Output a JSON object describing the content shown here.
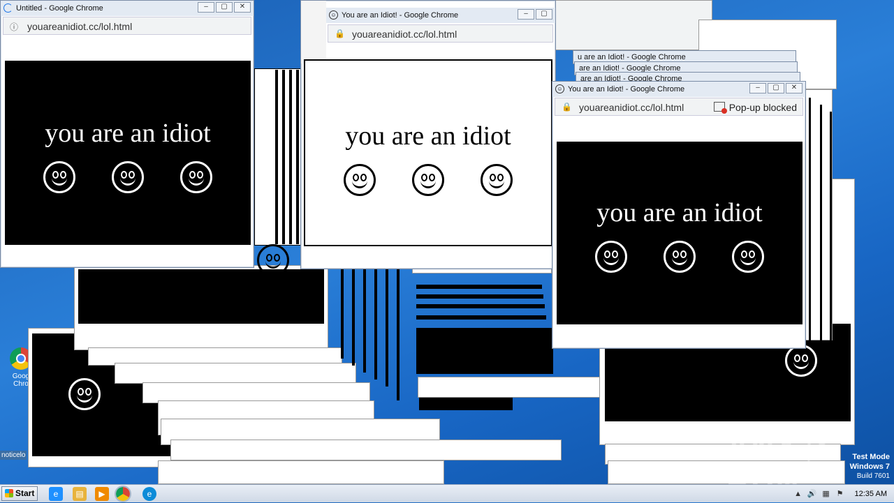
{
  "desktop": {
    "icon_chrome_label": "Goog\nChro",
    "icon_bottom_label": "noticelo",
    "watermark": "ANY ▷ RUN",
    "testmode": {
      "line1": "Test Mode",
      "line2": "Windows 7",
      "line3": "Build 7601"
    }
  },
  "popups": {
    "main_text": "you are an idiot",
    "url": "youareanidiot.cc/lol.html",
    "win1_title": "Untitled - Google Chrome",
    "win2_title": "You are an Idiot! - Google Chrome",
    "win3_title": "You are an Idiot! - Google Chrome",
    "popup_blocked": "Pop-up blocked",
    "bg_title_top": "You are an Idiot! - Google Chrome",
    "bg_title_a": "u are an Idiot! - Google Chrome",
    "bg_title_b": "are an Idiot! - Google Chrome",
    "bg_title_c": "are an Idiot! - Google Chrome"
  },
  "taskbar": {
    "start_label": "Start",
    "clock": "12:35 AM",
    "pinned": [
      "internet-explorer-icon",
      "file-explorer-icon",
      "media-player-icon",
      "chrome-icon",
      "edge-icon"
    ]
  },
  "colors": {
    "desktop_blue": "#1a5fb4",
    "taskbar": "#dce4ee"
  }
}
